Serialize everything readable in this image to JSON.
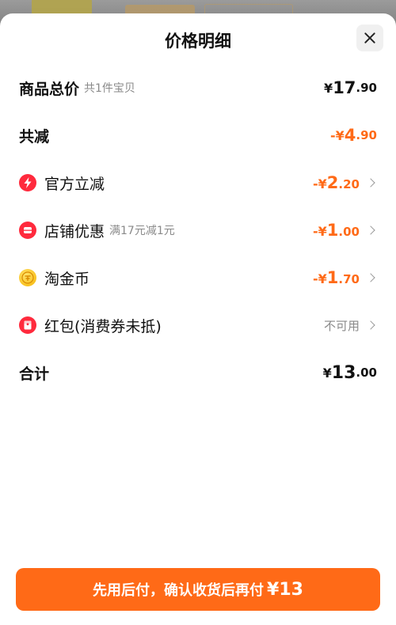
{
  "title": "价格明细",
  "rows": {
    "goods_total": {
      "label": "商品总价",
      "sub": "共1件宝贝",
      "cur": "¥",
      "int": "17",
      "dec": ".90"
    },
    "total_reduce": {
      "label": "共减",
      "cur": "-¥",
      "int": "4",
      "dec": ".90"
    },
    "official": {
      "label": "官方立减",
      "cur": "-¥",
      "int": "2",
      "dec": ".20",
      "icon": "lightning-icon"
    },
    "store": {
      "label": "店铺优惠",
      "sub": "满17元减1元",
      "cur": "-¥",
      "int": "1",
      "dec": ".00",
      "icon": "store-icon"
    },
    "coins": {
      "label": "淘金币",
      "cur": "-¥",
      "int": "1",
      "dec": ".70",
      "icon": "coin-icon"
    },
    "redpacket": {
      "label": "红包(消费券未抵)",
      "status": "不可用",
      "icon": "red-packet-icon"
    },
    "sum": {
      "label": "合计",
      "cur": "¥",
      "int": "13",
      "dec": ".00"
    }
  },
  "cta": {
    "label": "先用后付，确认收货后再付",
    "price": "¥13"
  },
  "colors": {
    "accent": "#ff6a17",
    "icon_red": "#ff2a3d",
    "coin_gold": "#f6b400"
  }
}
